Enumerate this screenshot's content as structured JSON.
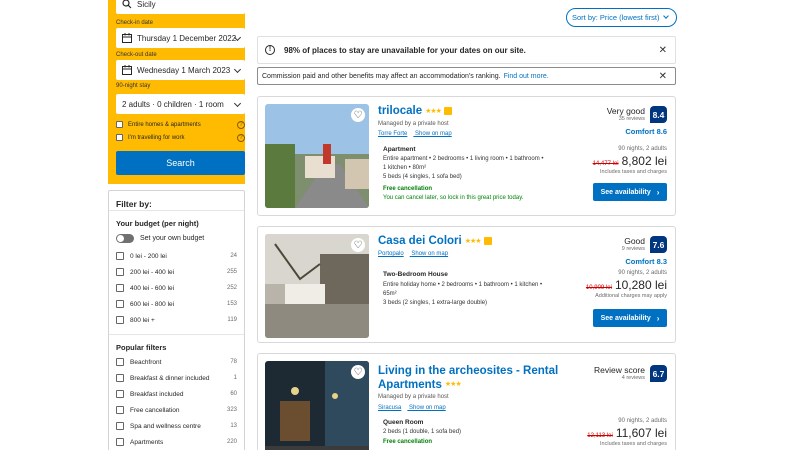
{
  "search": {
    "destination": "Sicily",
    "checkin_label": "Check-in date",
    "checkin_value": "Thursday 1 December 2022",
    "checkout_label": "Check-out date",
    "checkout_value": "Wednesday 1 March 2023",
    "stay_label": "90-night stay",
    "guests_value": "2 adults · 0 children · 1 room",
    "opt_entire_homes": "Entire homes & apartments",
    "opt_work": "I'm travelling for work",
    "search_button": "Search"
  },
  "filters": {
    "title": "Filter by:",
    "budget_title": "Your budget (per night)",
    "budget_toggle": "Set your own budget",
    "budget_items": [
      {
        "label": "0 lei - 200 lei",
        "count": "24"
      },
      {
        "label": "200 lei - 400 lei",
        "count": "255"
      },
      {
        "label": "400 lei - 600 lei",
        "count": "252"
      },
      {
        "label": "600 lei - 800 lei",
        "count": "153"
      },
      {
        "label": "800 lei +",
        "count": "119"
      }
    ],
    "popular_title": "Popular filters",
    "popular_items": [
      {
        "label": "Beachfront",
        "count": "78"
      },
      {
        "label": "Breakfast & dinner included",
        "count": "1"
      },
      {
        "label": "Breakfast included",
        "count": "60"
      },
      {
        "label": "Free cancellation",
        "count": "323"
      },
      {
        "label": "Spa and wellness centre",
        "count": "13"
      },
      {
        "label": "Apartments",
        "count": "220"
      }
    ]
  },
  "sort": {
    "label": "Sort by: Price (lowest first)"
  },
  "alert": {
    "text": "98% of places to stay are unavailable for your dates on our site."
  },
  "commission": {
    "text": "Commission paid and other benefits may affect an accommodation's ranking.",
    "link": "Find out more."
  },
  "listings": [
    {
      "title": "trilocale",
      "stars": "★★★",
      "managed": "Managed by a private host",
      "location": "Torre Forte",
      "map_link": "Show on map",
      "room_type": "Apartment",
      "desc1": "Entire apartment • 2 bedrooms • 1 living room • 1 bathroom •",
      "desc2": "1 kitchen • 80m²",
      "desc3": "5 beds (4 singles, 1 sofa bed)",
      "free_cancel": "Free cancellation",
      "free_sub": "You can cancel later, so lock in this great price today.",
      "rating_word": "Very good",
      "reviews": "35 reviews",
      "score": "8.4",
      "comfort": "Comfort 8.6",
      "nights": "90 nights, 2 adults",
      "old_price": "14,477 lei",
      "price": "8,802 lei",
      "taxes": "Includes taxes and charges",
      "button": "See availability"
    },
    {
      "title": "Casa dei Colori",
      "stars": "★★★",
      "managed": "",
      "location": "Portopalo",
      "map_link": "Show on map",
      "room_type": "Two-Bedroom House",
      "desc1": "Entire holiday home • 2 bedrooms • 1 bathroom • 1 kitchen •",
      "desc2": "65m²",
      "desc3": "3 beds (2 singles, 1 extra-large double)",
      "rating_word": "Good",
      "reviews": "9 reviews",
      "score": "7.6",
      "comfort": "Comfort 8.3",
      "nights": "90 nights, 2 adults",
      "old_price": "10,909 lei",
      "price": "10,280 lei",
      "taxes": "Additional charges may apply",
      "button": "See availability"
    },
    {
      "title_line1": "Living in the archeosites - Rental",
      "title_line2": "Apartments",
      "stars": "★★★",
      "managed": "Managed by a private host",
      "location": "Siracusa",
      "map_link": "Show on map",
      "room_type": "Queen Room",
      "desc1": "2 beds (1 double, 1 sofa bed)",
      "free_cancel": "Free cancellation",
      "rating_word": "Review score",
      "reviews": "4 reviews",
      "score": "6.7",
      "nights": "90 nights, 2 adults",
      "old_price": "12,113 lei",
      "price": "11,607 lei",
      "taxes": "Includes taxes and charges"
    }
  ]
}
